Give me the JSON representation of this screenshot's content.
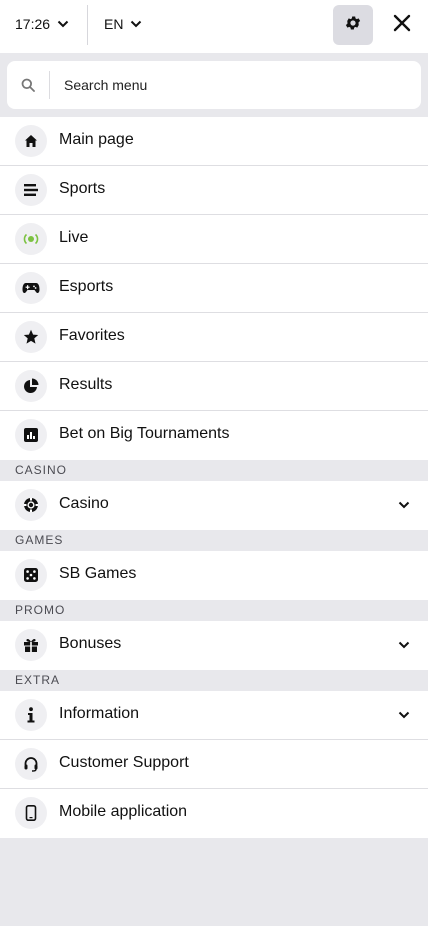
{
  "topbar": {
    "time": "17:26",
    "language": "EN"
  },
  "search": {
    "placeholder": "Search menu"
  },
  "menu": {
    "main_items": [
      {
        "label": "Main page",
        "icon": "home-icon"
      },
      {
        "label": "Sports",
        "icon": "list-icon"
      },
      {
        "label": "Live",
        "icon": "live-broadcast-icon"
      },
      {
        "label": "Esports",
        "icon": "gamepad-icon"
      },
      {
        "label": "Favorites",
        "icon": "star-icon"
      },
      {
        "label": "Results",
        "icon": "pie-chart-icon"
      },
      {
        "label": "Bet on Big Tournaments",
        "icon": "bar-chart-icon"
      }
    ],
    "casino_section": "CASINO",
    "casino": {
      "label": "Casino",
      "icon": "casino-chip-icon"
    },
    "games_section": "GAMES",
    "sb_games": {
      "label": "SB Games",
      "icon": "dice-icon"
    },
    "promo_section": "PROMO",
    "bonuses": {
      "label": "Bonuses",
      "icon": "gift-icon"
    },
    "extra_section": "EXTRA",
    "information": {
      "label": "Information",
      "icon": "info-icon"
    },
    "customer_support": {
      "label": "Customer Support",
      "icon": "headset-icon"
    },
    "mobile_app": {
      "label": "Mobile application",
      "icon": "smartphone-icon"
    }
  },
  "colors": {
    "live_dot": "#7cc242",
    "background": "#e8e8ec"
  }
}
